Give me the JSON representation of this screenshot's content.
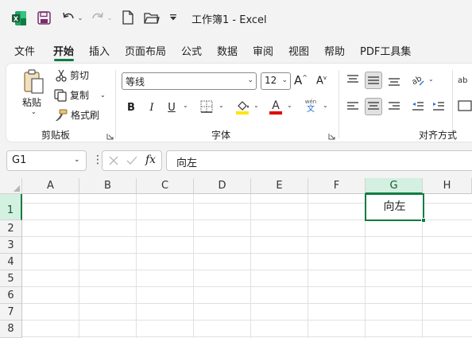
{
  "window": {
    "title": "工作簿1  -  Excel"
  },
  "tabs": [
    {
      "label": "文件",
      "active": false
    },
    {
      "label": "开始",
      "active": true
    },
    {
      "label": "插入",
      "active": false
    },
    {
      "label": "页面布局",
      "active": false
    },
    {
      "label": "公式",
      "active": false
    },
    {
      "label": "数据",
      "active": false
    },
    {
      "label": "审阅",
      "active": false
    },
    {
      "label": "视图",
      "active": false
    },
    {
      "label": "帮助",
      "active": false
    },
    {
      "label": "PDF工具集",
      "active": false
    }
  ],
  "ribbon": {
    "clipboard": {
      "paste_label": "粘贴",
      "cut_label": "剪切",
      "copy_label": "复制",
      "format_painter_label": "格式刷",
      "group_label": "剪贴板"
    },
    "font": {
      "font_name": "等线",
      "font_size": "12",
      "bold": "B",
      "italic": "I",
      "underline": "U",
      "group_label": "字体",
      "phonetic_top": "wén",
      "phonetic_bottom": "文"
    },
    "alignment": {
      "group_label": "对齐方式"
    }
  },
  "formula_bar": {
    "name_box": "G1",
    "fx": "fx",
    "content": "向左"
  },
  "grid": {
    "columns": [
      "A",
      "B",
      "C",
      "D",
      "E",
      "F",
      "G",
      "H"
    ],
    "rows": [
      "1",
      "2",
      "3",
      "4",
      "5",
      "6",
      "7",
      "8"
    ],
    "selected_column": "G",
    "selected_row": "1",
    "active_cell_value": "向左"
  },
  "colors": {
    "excel_green": "#107c41",
    "highlight_yellow": "#ffe600",
    "font_red": "#e00000"
  }
}
